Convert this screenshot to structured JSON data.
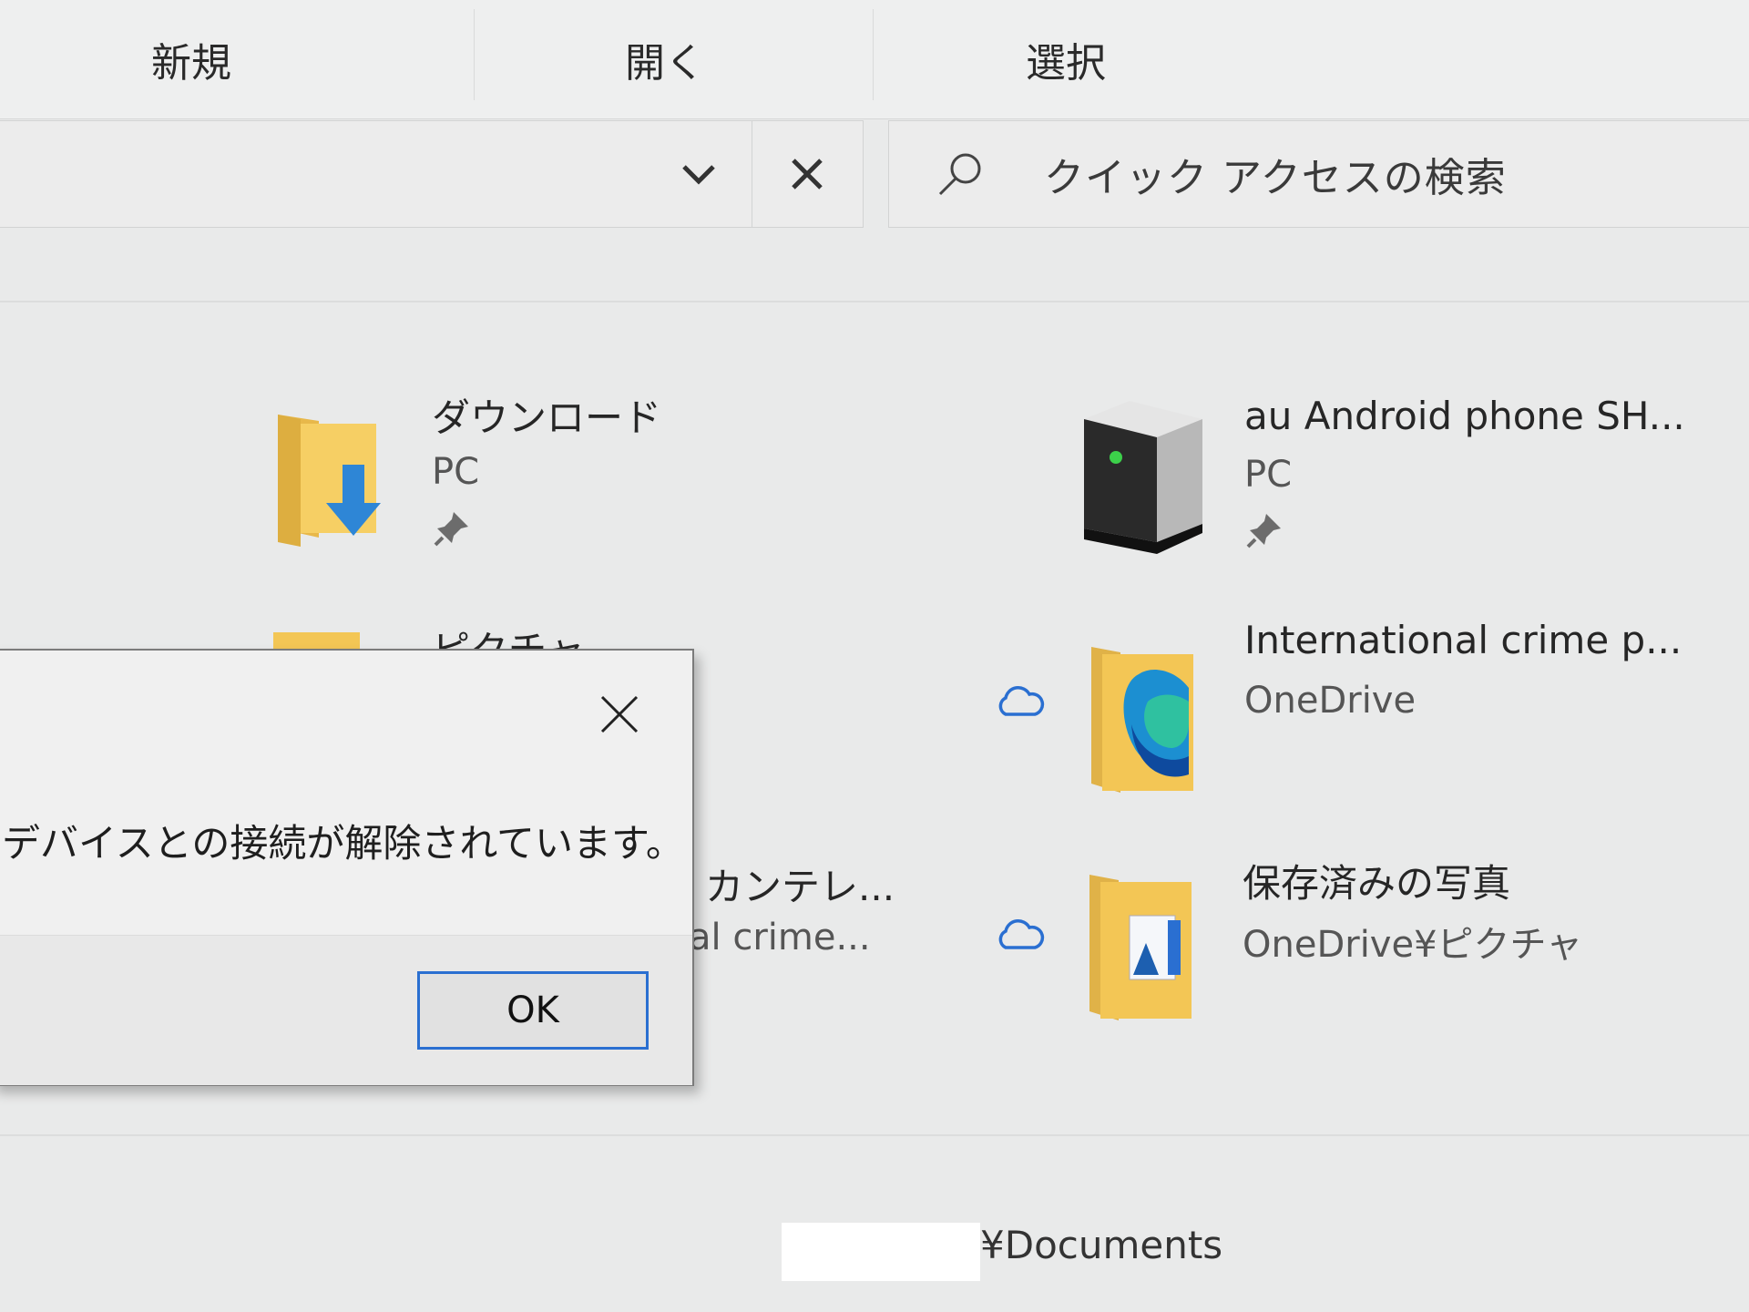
{
  "ribbon": {
    "new_label": "新規",
    "open_label": "開く",
    "select_label": "選択"
  },
  "search": {
    "placeholder": "クイック アクセスの検索"
  },
  "quick_access": {
    "items": [
      {
        "name": "ダウンロード",
        "location": "PC",
        "pinned": true,
        "icon": "downloads-folder-icon"
      },
      {
        "name": "au Android phone SH...",
        "location": "PC",
        "pinned": true,
        "icon": "device-drive-icon"
      },
      {
        "name": "ピクチャ",
        "location": "",
        "pinned": false,
        "icon": "pictures-folder-icon"
      },
      {
        "name": "International crime p...",
        "location": "OneDrive",
        "pinned": false,
        "cloud": true,
        "icon": "onedrive-folder-icon"
      },
      {
        "name": "カンテレ...",
        "location": "al crime...",
        "pinned": false,
        "icon": "folder-icon"
      },
      {
        "name": "保存済みの写真",
        "location": "OneDrive¥ピクチャ",
        "pinned": false,
        "cloud": true,
        "icon": "saved-pictures-folder-icon"
      }
    ]
  },
  "dialog": {
    "message": "デバイスとの接続が解除されています。",
    "ok_label": "OK"
  },
  "status": {
    "path_suffix": "¥Documents"
  },
  "colors": {
    "accent": "#2a6fd1",
    "folder": "#f3c655",
    "cloud": "#2a6fd1"
  }
}
